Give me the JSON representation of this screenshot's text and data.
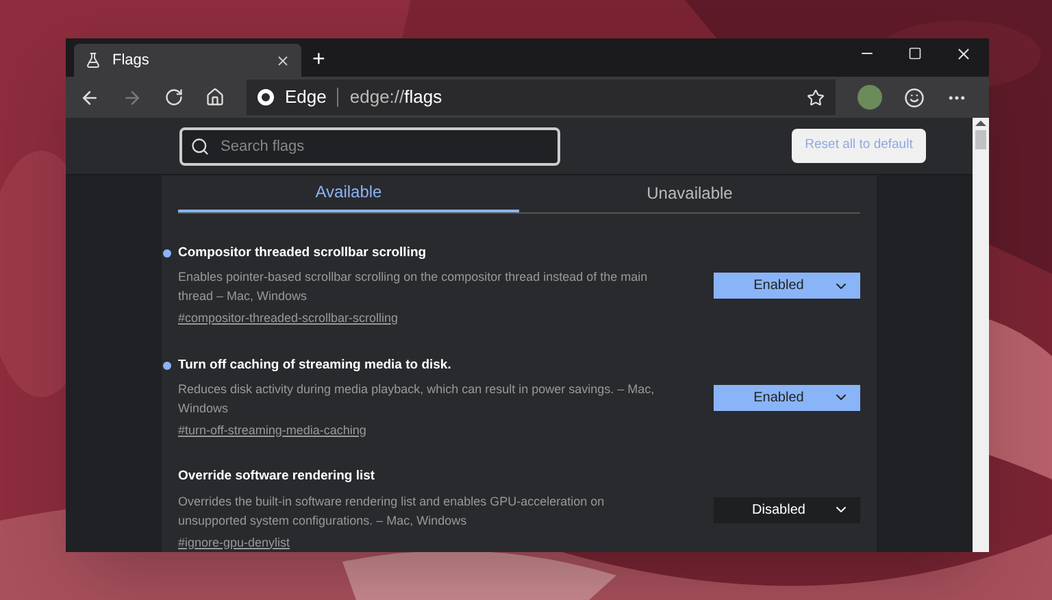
{
  "window": {
    "tab_title": "Flags",
    "new_tab": "+"
  },
  "toolbar": {
    "site_name": "Edge",
    "address": "edge://",
    "address_bold": "flags"
  },
  "search": {
    "placeholder": "Search flags"
  },
  "reset_button": "Reset all to default",
  "tabs": [
    {
      "label": "Available",
      "selected": true
    },
    {
      "label": "Unavailable",
      "selected": false
    }
  ],
  "flags": [
    {
      "title": "Compositor threaded scrollbar scrolling",
      "modified": true,
      "description": "Enables pointer-based scrollbar scrolling on the compositor thread instead of the main thread – Mac, Windows",
      "link": "#compositor-threaded-scrollbar-scrolling",
      "value": "Enabled"
    },
    {
      "title": "Turn off caching of streaming media to disk.",
      "modified": true,
      "description": "Reduces disk activity during media playback, which can result in power savings. – Mac, Windows",
      "link": "#turn-off-streaming-media-caching",
      "value": "Enabled"
    },
    {
      "title": "Override software rendering list",
      "modified": false,
      "description": "Overrides the built-in software rendering list and enables GPU-acceleration on unsupported system configurations. – Mac, Windows",
      "link": "#ignore-gpu-denylist",
      "value": "Disabled"
    }
  ]
}
